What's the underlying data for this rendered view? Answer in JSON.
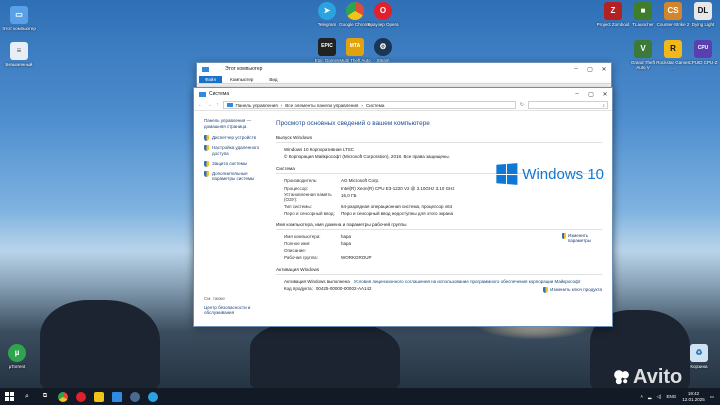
{
  "desktop": {
    "icons_left": [
      {
        "label": "Этот компьютер",
        "icon": "computer-icon",
        "color": "#5aa0e6"
      },
      {
        "label": "Безымянный",
        "icon": "document-icon",
        "color": "#e8eef5"
      }
    ],
    "icons_top": [
      {
        "label": "Telegram",
        "icon": "telegram-icon",
        "color": "#2aa3e0"
      },
      {
        "label": "Google Chrome",
        "icon": "chrome-icon",
        "color": "#e24b3b"
      },
      {
        "label": "Браузер Opera",
        "icon": "opera-icon",
        "color": "#e0202c"
      },
      {
        "label": "Epic Games Launcher",
        "icon": "epic-icon",
        "color": "#222222"
      },
      {
        "label": "Multi Theft Auto",
        "icon": "mta-icon",
        "color": "#e0a20f"
      },
      {
        "label": "Steam",
        "icon": "steam-icon",
        "color": "#1b3554"
      }
    ],
    "icons_right": [
      {
        "label": "Project Zomboid",
        "icon": "zomboid-icon",
        "color": "#b32121"
      },
      {
        "label": "TLauncher",
        "icon": "tlauncher-icon",
        "color": "#3f7d2a"
      },
      {
        "label": "Counter-Strike 2",
        "icon": "cs2-icon",
        "color": "#d1862b"
      },
      {
        "label": "Dying Light",
        "icon": "dyinglight-icon",
        "color": "#e8e8e8"
      },
      {
        "label": "Grand Theft Auto V",
        "icon": "gta-icon",
        "color": "#3c7a3a"
      },
      {
        "label": "Rockstar Games ...",
        "icon": "rockstar-icon",
        "color": "#f2b81a"
      },
      {
        "label": "CPUID CPU-Z",
        "icon": "cpuz-icon",
        "color": "#5a3fb0"
      }
    ],
    "utorrent_label": "µTorrent",
    "recycle_label": "Корзина",
    "watermark": "Avito"
  },
  "explorer_back": {
    "title": "Этот компьютер",
    "ribbon_tabs": [
      "Файл",
      "Компьютер",
      "Вид"
    ]
  },
  "system_window": {
    "title": "Система",
    "breadcrumb": [
      "Панель управления",
      "Все элементы панели управления",
      "Система"
    ],
    "search_placeholder": "",
    "left_pane": {
      "home": "Панель управления — домашняя страница",
      "links": [
        "Диспетчер устройств",
        "Настройка удаленного доступа",
        "Защита системы",
        "Дополнительные параметры системы"
      ],
      "see_also_title": "См. также",
      "see_also_links": [
        "Центр безопасности и обслуживания"
      ]
    },
    "heading": "Просмотр основных сведений о вашем компьютере",
    "edition": {
      "title": "Выпуск Windows",
      "name": "Windows 10 Корпоративная LTSC",
      "copyright": "© Корпорация Майкрософт (Microsoft Corporation), 2018. Все права защищены.",
      "logo_text": "Windows 10"
    },
    "system": {
      "title": "Система",
      "rows": [
        {
          "k": "Производитель:",
          "v": "AG Microsoft Corp."
        },
        {
          "k": "Процессор:",
          "v": "Intel(R) Xeon(R) CPU E3-1220 V2 @ 3.10GHz   3.10 GHz"
        },
        {
          "k": "Установленная память (ОЗУ):",
          "v": "16,0 ГБ"
        },
        {
          "k": "Тип системы:",
          "v": "64-разрядная операционная система, процессор x64"
        },
        {
          "k": "Перо и сенсорный ввод:",
          "v": "Перо и сенсорный ввод недоступны для этого экрана"
        }
      ]
    },
    "computer_name": {
      "title": "Имя компьютера, имя домена и параметры рабочей группы",
      "rows": [
        {
          "k": "Имя компьютера:",
          "v": "hapa"
        },
        {
          "k": "Полное имя:",
          "v": "hapa"
        },
        {
          "k": "Описание:",
          "v": ""
        },
        {
          "k": "Рабочая группа:",
          "v": "WORKGROUP"
        }
      ],
      "change_link": "Изменить параметры"
    },
    "activation": {
      "title": "Активация Windows",
      "status": "Активация Windows выполнена",
      "license_link": "Условия лицензионного соглашения на использование программного обеспечения корпорации Майкрософт",
      "product_key_label": "Код продукта:",
      "product_key": "00425-00000-00002-AA142",
      "change_key_link": "Изменить ключ продукта"
    }
  },
  "taskbar": {
    "lang": "ENG",
    "time": "19:42",
    "date": "12.01.2025",
    "apps": [
      {
        "icon": "chrome-icon",
        "color": "#e24b3b"
      },
      {
        "icon": "opera-icon",
        "color": "#e0202c"
      },
      {
        "icon": "files-icon",
        "color": "#f0c419"
      },
      {
        "icon": "explorer-icon",
        "color": "#2f8ae0"
      },
      {
        "icon": "steam-icon",
        "color": "#1b3554"
      },
      {
        "icon": "telegram-icon",
        "color": "#2aa3e0"
      }
    ]
  }
}
